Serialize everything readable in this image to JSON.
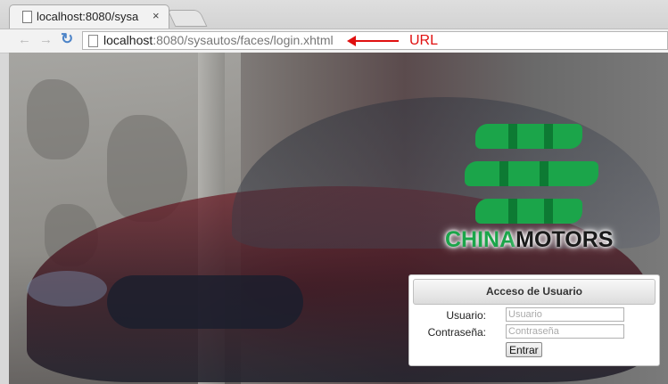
{
  "browser": {
    "tab_title": "localhost:8080/sysa",
    "tab_close": "×",
    "url_host": "localhost",
    "url_rest": ":8080/sysautos/faces/login.xhtml",
    "annotation_label": "URL",
    "annotation_color": "#e01010"
  },
  "brand": {
    "part1": "CHINA",
    "part2": "MOTORS",
    "green": "#1ba54a"
  },
  "login": {
    "title": "Acceso de Usuario",
    "user_label": "Usuario:",
    "user_placeholder": "Usuario",
    "pass_label": "Contraseña:",
    "pass_placeholder": "Contraseña",
    "submit_label": "Entrar"
  }
}
